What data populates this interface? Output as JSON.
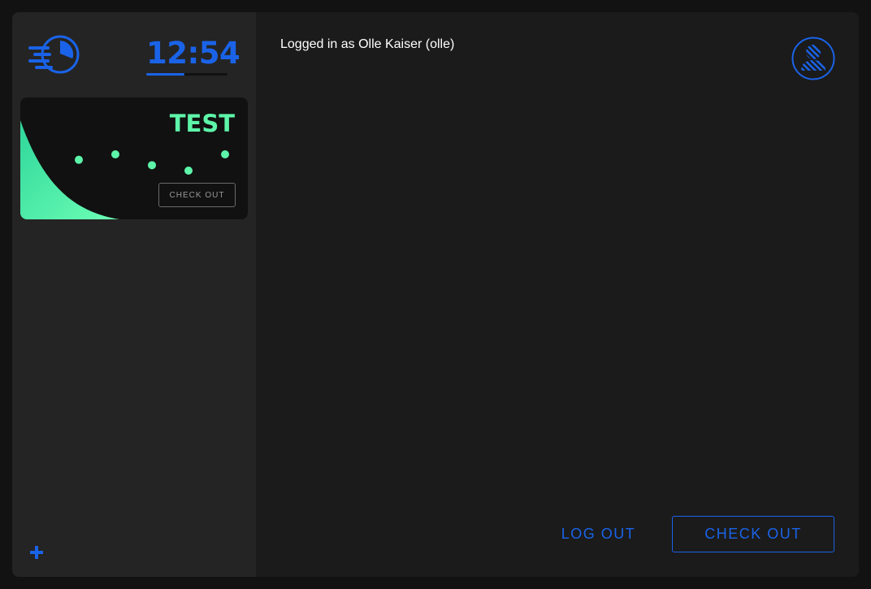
{
  "colors": {
    "accent": "#1a63e8",
    "card_accent": "#5df5a9",
    "background": "#1b1b1b",
    "sidebar": "#242424",
    "card": "#111111"
  },
  "sidebar": {
    "logo_icon": "clock-speed-icon",
    "clock": {
      "time": "12:54",
      "progress": 0.47
    },
    "cards": [
      {
        "title": "TEST",
        "sparkline_values": [
          3,
          4,
          2,
          1,
          4
        ],
        "checkout_label": "CHECK OUT"
      }
    ],
    "add_icon": "plus-icon"
  },
  "main": {
    "login_text": "Logged in as Olle Kaiser (olle)",
    "avatar_icon": "user-avatar-icon",
    "logout_label": "LOG OUT",
    "checkout_label": "CHECK OUT"
  }
}
